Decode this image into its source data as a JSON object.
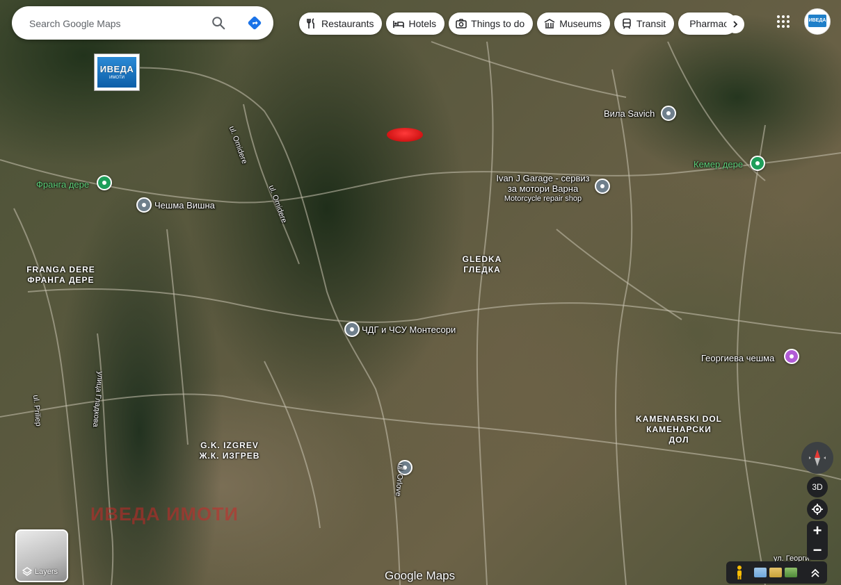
{
  "search": {
    "placeholder": "Search Google Maps"
  },
  "chips": [
    {
      "label": "Restaurants",
      "icon": "restaurant-icon"
    },
    {
      "label": "Hotels",
      "icon": "hotel-icon"
    },
    {
      "label": "Things to do",
      "icon": "camera-icon"
    },
    {
      "label": "Museums",
      "icon": "museum-icon"
    },
    {
      "label": "Transit",
      "icon": "transit-icon"
    },
    {
      "label": "Pharmacies",
      "icon": "pharmacy-icon"
    }
  ],
  "logo": {
    "text": "ИВЕДА",
    "subtext": "ИМОТИ"
  },
  "watermark": "ИВЕДА ИМОТИ",
  "places": {
    "vila_savich": "Вила Savich",
    "garage_name": "Ivan J Garage - сервиз",
    "garage_name2": "за мотори Варна",
    "garage_type": "Motorcycle repair shop",
    "kemer_dere": "Кемер дере",
    "franga_dere": "Франга дере",
    "cheshma_vishna": "Чешма Вишна",
    "montesori": "ЧДГ и ЧСУ Монтесори",
    "georgieva_cheshma": "Георгиева чешма"
  },
  "areas": {
    "franga_dere_lat": "FRANGA DERE",
    "franga_dere_cyr": "ФРАНГА ДЕРЕ",
    "gledka_lat": "GLEDKA",
    "gledka_cyr": "ГЛЕДКА",
    "izgrev_lat": "G.K. IZGREV",
    "izgrev_cyr": "Ж.К. ИЗГРЕВ",
    "kamenarski_lat": "KAMENARSKI DOL",
    "kamenarski_cyr1": "КАМЕНАРСКИ",
    "kamenarski_cyr2": "ДОЛ"
  },
  "streets": {
    "omidere1": "ul. Omidere",
    "omidere2": "ul. Omidere",
    "priliep": "ul. Priliep",
    "gladkova": "улица Гладкова",
    "georgi": "ул. Георги",
    "orlove": "ul. Orlove"
  },
  "controls": {
    "layers": "Layers",
    "btn_3d": "3D",
    "zoom_in": "+",
    "zoom_out": "−"
  },
  "footer_logo": "Google Maps",
  "colors": {
    "accent": "#1a73e8",
    "pin_green": "#1e9e5a",
    "pin_purple": "#b15bd6",
    "watermark": "#c82828"
  }
}
